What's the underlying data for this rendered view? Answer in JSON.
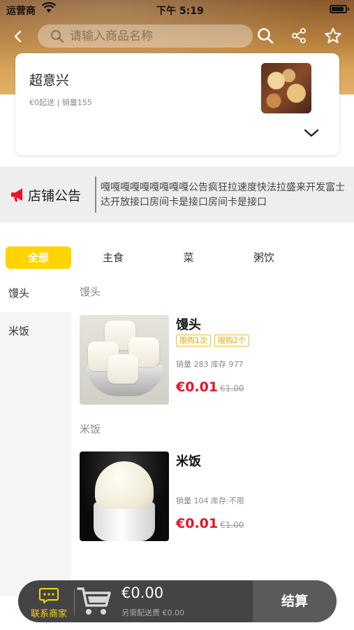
{
  "status_bar": {
    "carrier": "运营商",
    "time": "下午 5:19"
  },
  "search": {
    "placeholder": "请输入商品名称"
  },
  "shop": {
    "name": "超意兴",
    "meta": "€0起送 | 销量155"
  },
  "notice": {
    "title": "店铺公告",
    "text": "嘎嘎嘎嘎嘎嘎嘎嘎嘎公告疯狂拉速度快法拉盛来开发富士达开放接口房间卡是接口房间卡是接口"
  },
  "tabs": [
    {
      "label": "全部",
      "active": true
    },
    {
      "label": "主食",
      "active": false
    },
    {
      "label": "菜",
      "active": false
    },
    {
      "label": "粥饮",
      "active": false
    }
  ],
  "side_nav": [
    {
      "label": "馒头",
      "active": true
    },
    {
      "label": "米饭",
      "active": false
    }
  ],
  "sections": [
    {
      "title": "馒头",
      "product": {
        "name": "馒头",
        "tags": [
          "限购1次",
          "限购2个"
        ],
        "stats": "销量 283 库存 977",
        "price": "€0.01",
        "original_price": "€1.00"
      }
    },
    {
      "title": "米饭",
      "product": {
        "name": "米饭",
        "tags": [],
        "stats": "销量 104 库存:不限",
        "price": "€0.01",
        "original_price": "€1.00"
      }
    }
  ],
  "cart": {
    "contact_label": "联系商家",
    "total": "€0.00",
    "delivery_note": "另需配送费 €0.00",
    "checkout_label": "结算"
  },
  "colors": {
    "accent": "#ffd400",
    "price": "#e8122a",
    "cart_bar": "#444444"
  }
}
